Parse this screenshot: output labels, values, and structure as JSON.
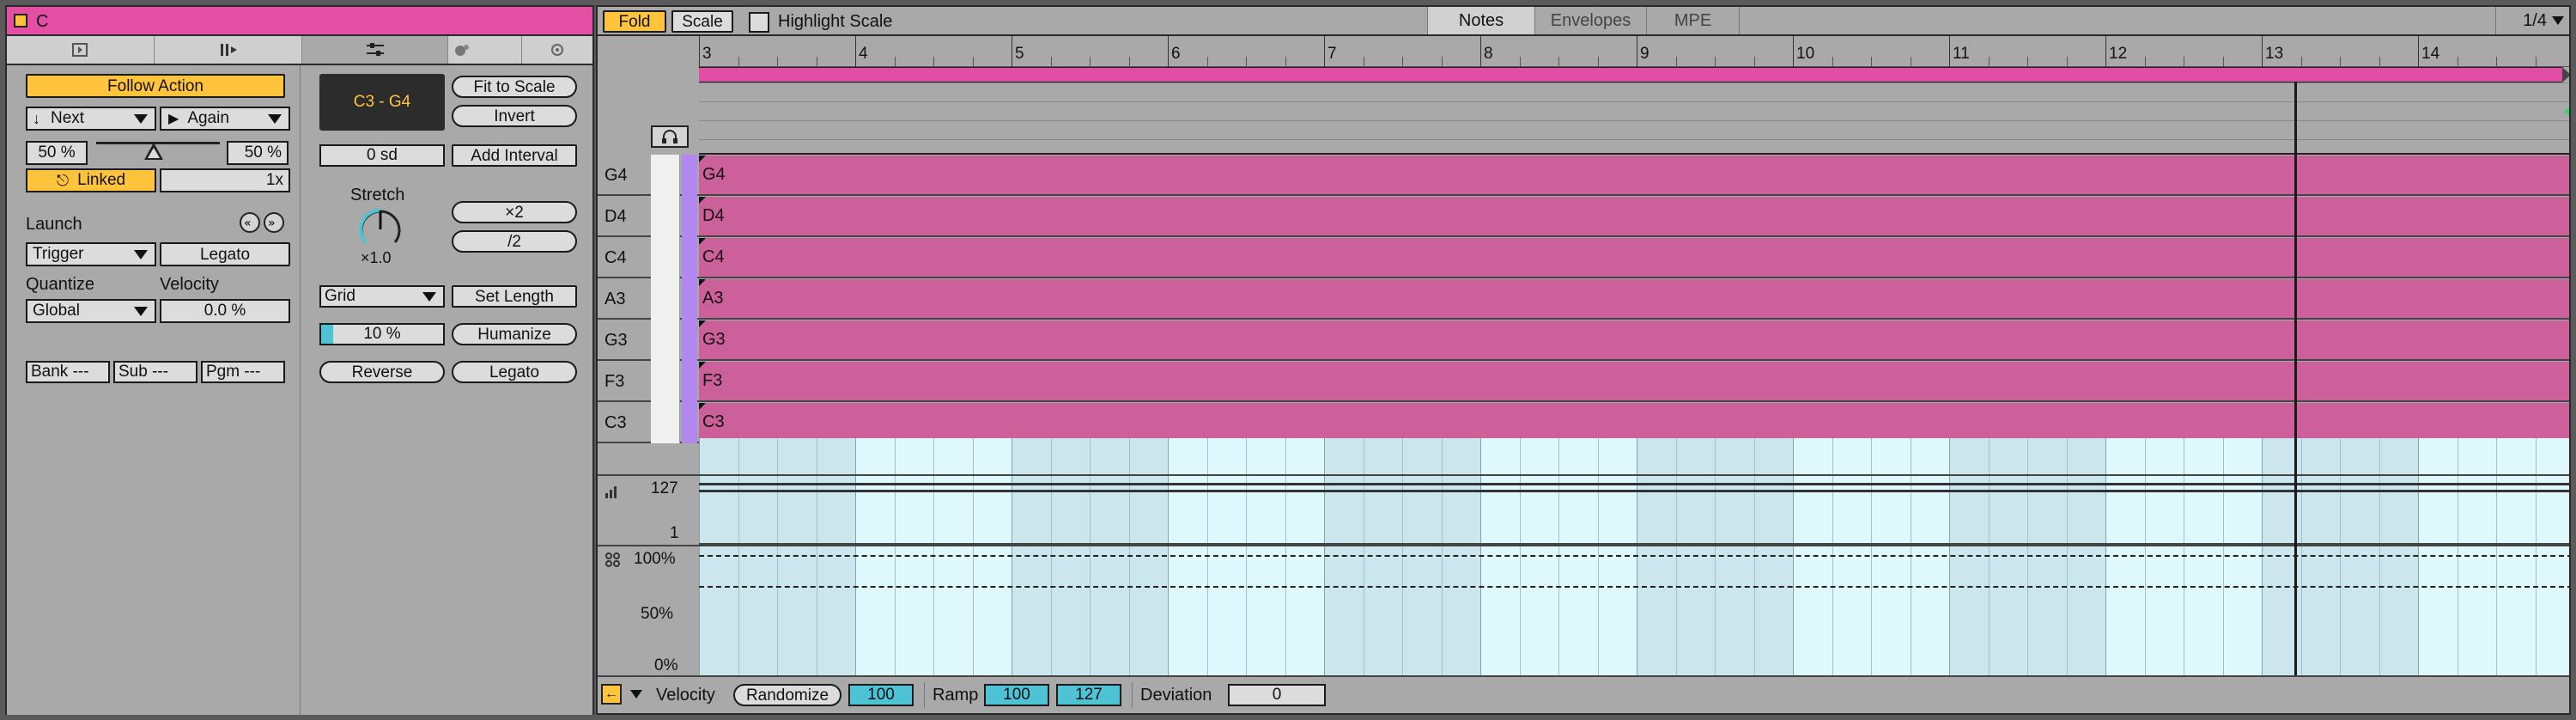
{
  "colors": {
    "accent": "#ffc43c",
    "clip": "#cc609a",
    "teal": "#4fc3d6",
    "grid_light": "#dff8fb",
    "grid_dark": "#cbe6ec",
    "purple": "#b387f0"
  },
  "clip": {
    "name": "C",
    "icon": "clip-color-icon"
  },
  "tabs": [
    {
      "icon": "clip-tab-icon"
    },
    {
      "icon": "notes-tab-icon"
    },
    {
      "icon": "envelope-tab-icon"
    },
    {
      "icon": "fx-tab-icon"
    },
    {
      "icon": "mpe-tab-icon"
    }
  ],
  "clip_panel": {
    "follow_action": "Follow Action",
    "action_a": "Next",
    "action_b": "Again",
    "chance_a": "50 %",
    "chance_b": "50 %",
    "linked": "Linked",
    "multiplier": "1x",
    "launch": "Launch",
    "launch_mode": "Trigger",
    "legato": "Legato",
    "quantize_label": "Quantize",
    "velocity_label": "Velocity",
    "quantize": "Global",
    "velocity": "0.0 %",
    "bank": "Bank ---",
    "sub": "Sub ---",
    "pgm": "Pgm ---"
  },
  "notes_panel": {
    "range": "C3 - G4",
    "fit_to_scale": "Fit to Scale",
    "invert": "Invert",
    "transpose": "0 sd",
    "add_interval": "Add Interval",
    "stretch": "Stretch",
    "stretch_value": "×1.0",
    "double": "×2",
    "half": "/2",
    "grid": "Grid",
    "set_length": "Set Length",
    "humanize_amount": "10 %",
    "humanize_fraction": 0.1,
    "humanize": "Humanize",
    "reverse": "Reverse",
    "legato": "Legato"
  },
  "toolbar": {
    "fold": "Fold",
    "scale": "Scale",
    "highlight_scale": "Highlight Scale",
    "tabs": [
      "Notes",
      "Envelopes",
      "MPE"
    ],
    "grid_size": "1/4"
  },
  "ruler": [
    "3",
    "4",
    "5",
    "6",
    "7",
    "8",
    "9",
    "10",
    "11",
    "12",
    "13",
    "14"
  ],
  "keys": [
    "G4",
    "D4",
    "C4",
    "A3",
    "G3",
    "F3",
    "C3"
  ],
  "notes": [
    "G4",
    "D4",
    "C4",
    "A3",
    "G3",
    "F3",
    "C3"
  ],
  "velocity_lane": {
    "max": "127",
    "min": "1"
  },
  "chance_lane": {
    "max": "100%",
    "mid": "50%",
    "min": "0%"
  },
  "bottom_bar": {
    "velocity": "Velocity",
    "randomize": "Randomize",
    "randomize_value": "100",
    "ramp": "Ramp",
    "ramp_start": "100",
    "ramp_end": "127",
    "deviation": "Deviation",
    "deviation_value": "0"
  }
}
